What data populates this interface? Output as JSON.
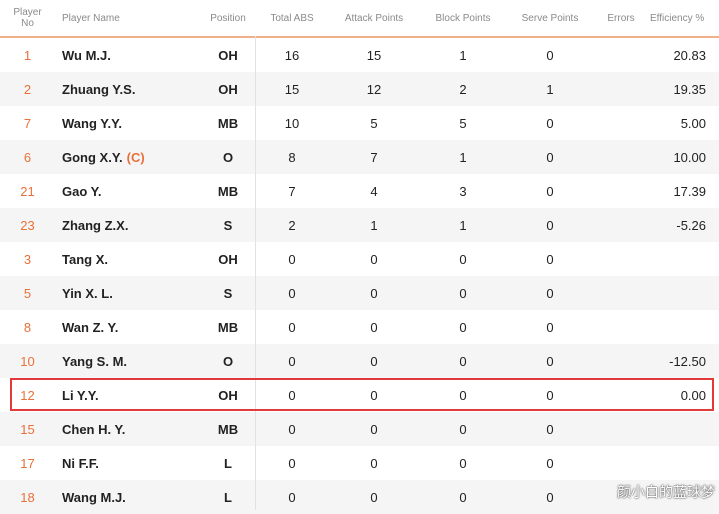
{
  "headers": {
    "no_line1": "Player",
    "no_line2": "No",
    "name": "Player Name",
    "position": "Position",
    "total": "Total ABS",
    "attack": "Attack Points",
    "block": "Block Points",
    "serve": "Serve Points",
    "errors": "Errors",
    "efficiency": "Efficiency %"
  },
  "rows": [
    {
      "no": "1",
      "name": "Wu M.J.",
      "captain": "",
      "pos": "OH",
      "total": "16",
      "attack": "15",
      "block": "1",
      "serve": "0",
      "eff": "20.83"
    },
    {
      "no": "2",
      "name": "Zhuang Y.S.",
      "captain": "",
      "pos": "OH",
      "total": "15",
      "attack": "12",
      "block": "2",
      "serve": "1",
      "eff": "19.35"
    },
    {
      "no": "7",
      "name": "Wang Y.Y.",
      "captain": "",
      "pos": "MB",
      "total": "10",
      "attack": "5",
      "block": "5",
      "serve": "0",
      "eff": "5.00"
    },
    {
      "no": "6",
      "name": "Gong X.Y.",
      "captain": "(C)",
      "pos": "O",
      "total": "8",
      "attack": "7",
      "block": "1",
      "serve": "0",
      "eff": "10.00"
    },
    {
      "no": "21",
      "name": "Gao Y.",
      "captain": "",
      "pos": "MB",
      "total": "7",
      "attack": "4",
      "block": "3",
      "serve": "0",
      "eff": "17.39"
    },
    {
      "no": "23",
      "name": "Zhang Z.X.",
      "captain": "",
      "pos": "S",
      "total": "2",
      "attack": "1",
      "block": "1",
      "serve": "0",
      "eff": "-5.26"
    },
    {
      "no": "3",
      "name": "Tang X.",
      "captain": "",
      "pos": "OH",
      "total": "0",
      "attack": "0",
      "block": "0",
      "serve": "0",
      "eff": ""
    },
    {
      "no": "5",
      "name": "Yin X. L.",
      "captain": "",
      "pos": "S",
      "total": "0",
      "attack": "0",
      "block": "0",
      "serve": "0",
      "eff": ""
    },
    {
      "no": "8",
      "name": "Wan Z. Y.",
      "captain": "",
      "pos": "MB",
      "total": "0",
      "attack": "0",
      "block": "0",
      "serve": "0",
      "eff": ""
    },
    {
      "no": "10",
      "name": "Yang S. M.",
      "captain": "",
      "pos": "O",
      "total": "0",
      "attack": "0",
      "block": "0",
      "serve": "0",
      "eff": "-12.50"
    },
    {
      "no": "12",
      "name": "Li Y.Y.",
      "captain": "",
      "pos": "OH",
      "total": "0",
      "attack": "0",
      "block": "0",
      "serve": "0",
      "eff": "0.00"
    },
    {
      "no": "15",
      "name": "Chen H. Y.",
      "captain": "",
      "pos": "MB",
      "total": "0",
      "attack": "0",
      "block": "0",
      "serve": "0",
      "eff": ""
    },
    {
      "no": "17",
      "name": "Ni F.F.",
      "captain": "",
      "pos": "L",
      "total": "0",
      "attack": "0",
      "block": "0",
      "serve": "0",
      "eff": ""
    },
    {
      "no": "18",
      "name": "Wang M.J.",
      "captain": "",
      "pos": "L",
      "total": "0",
      "attack": "0",
      "block": "0",
      "serve": "0",
      "eff": ""
    }
  ],
  "highlighted_player": "Li Y.Y.",
  "watermark": "颜小白的蓝球梦",
  "colors": {
    "accent": "#e8703a",
    "highlight": "#e23a3a",
    "alt_row": "#f5f5f5"
  }
}
